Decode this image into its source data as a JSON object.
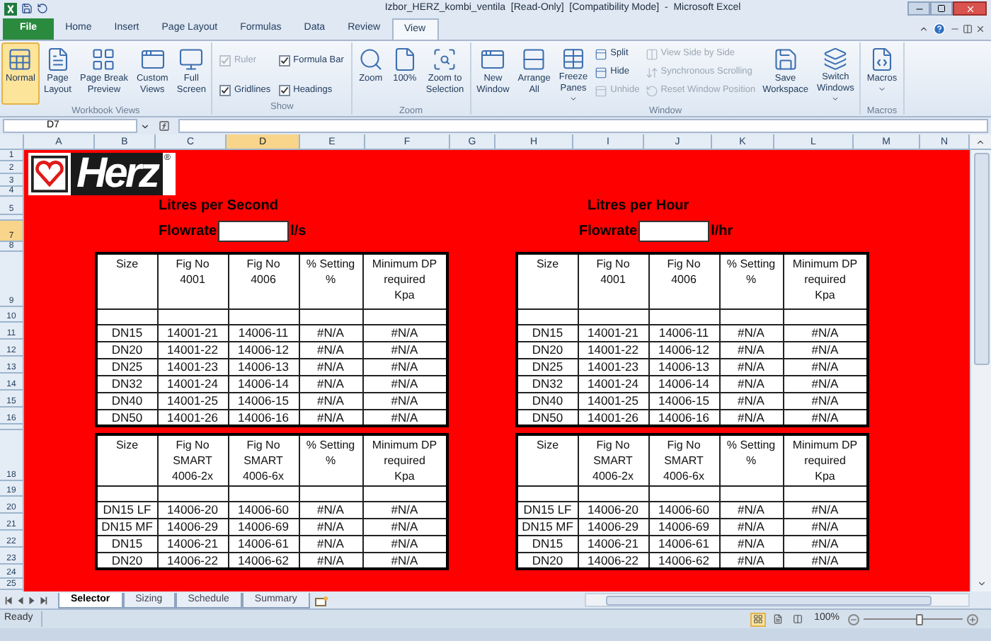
{
  "window": {
    "title": "Izbor_HERZ_kombi_ventila  [Read-Only]  [Compatibility Mode]  -  Microsoft Excel"
  },
  "ribbon_tabs": [
    {
      "label": "File",
      "kind": "file",
      "selected": false
    },
    {
      "label": "Home",
      "kind": "tab",
      "selected": false
    },
    {
      "label": "Insert",
      "kind": "tab",
      "selected": false
    },
    {
      "label": "Page Layout",
      "kind": "tab",
      "selected": false
    },
    {
      "label": "Formulas",
      "kind": "tab",
      "selected": false
    },
    {
      "label": "Data",
      "kind": "tab",
      "selected": false
    },
    {
      "label": "Review",
      "kind": "tab",
      "selected": false
    },
    {
      "label": "View",
      "kind": "tab",
      "selected": true
    }
  ],
  "ribbon_groups": [
    {
      "label": "Workbook Views",
      "items": [
        {
          "kind": "large",
          "label": "Normal",
          "selected": true
        },
        {
          "kind": "large",
          "label": "Page\nLayout",
          "selected": false
        },
        {
          "kind": "large",
          "label": "Page Break\nPreview",
          "selected": false
        },
        {
          "kind": "large",
          "label": "Custom\nViews",
          "selected": false
        },
        {
          "kind": "large",
          "label": "Full\nScreen",
          "selected": false
        }
      ]
    },
    {
      "label": "Show",
      "items": [
        {
          "kind": "check",
          "label": "Ruler",
          "checked": true,
          "disabled": true
        },
        {
          "kind": "check",
          "label": "Gridlines",
          "checked": true,
          "disabled": false
        },
        {
          "kind": "check",
          "label": "Formula Bar",
          "checked": true,
          "disabled": false
        },
        {
          "kind": "check",
          "label": "Headings",
          "checked": true,
          "disabled": false
        }
      ]
    },
    {
      "label": "Zoom",
      "items": [
        {
          "kind": "large",
          "label": "Zoom",
          "selected": false
        },
        {
          "kind": "large",
          "label": "100%",
          "selected": false
        },
        {
          "kind": "large",
          "label": "Zoom to\nSelection",
          "selected": false
        }
      ]
    },
    {
      "label": "Window",
      "items": [
        {
          "kind": "large",
          "label": "New\nWindow",
          "selected": false
        },
        {
          "kind": "large",
          "label": "Arrange\nAll",
          "selected": false
        },
        {
          "kind": "large",
          "label": "Freeze\nPanes",
          "selected": false,
          "dropdown": true
        },
        {
          "kind": "stack",
          "items": [
            {
              "label": "Split",
              "disabled": false
            },
            {
              "label": "Hide",
              "disabled": false
            },
            {
              "label": "Unhide",
              "disabled": true
            }
          ]
        },
        {
          "kind": "stack",
          "items": [
            {
              "label": "View Side by Side",
              "disabled": true
            },
            {
              "label": "Synchronous Scrolling",
              "disabled": true
            },
            {
              "label": "Reset Window Position",
              "disabled": true
            }
          ]
        },
        {
          "kind": "large",
          "label": "Save\nWorkspace",
          "selected": false
        },
        {
          "kind": "large",
          "label": "Switch\nWindows",
          "selected": false,
          "dropdown": true
        }
      ]
    },
    {
      "label": "Macros",
      "items": [
        {
          "kind": "large",
          "label": "Macros",
          "selected": false,
          "dropdown": true
        }
      ]
    }
  ],
  "formula_bar": {
    "name_box": "D7"
  },
  "column_headers": [
    {
      "label": "A",
      "selected": false
    },
    {
      "label": "B",
      "selected": false
    },
    {
      "label": "C",
      "selected": false
    },
    {
      "label": "D",
      "selected": true
    },
    {
      "label": "E",
      "selected": false
    },
    {
      "label": "F",
      "selected": false
    },
    {
      "label": "G",
      "selected": false
    },
    {
      "label": "H",
      "selected": false
    },
    {
      "label": "I",
      "selected": false
    },
    {
      "label": "J",
      "selected": false
    },
    {
      "label": "K",
      "selected": false
    },
    {
      "label": "L",
      "selected": false
    },
    {
      "label": "M",
      "selected": false
    },
    {
      "label": "N",
      "selected": false
    }
  ],
  "row_headers": [
    {
      "label": "1",
      "selected": false
    },
    {
      "label": "2",
      "selected": false
    },
    {
      "label": "3",
      "selected": false
    },
    {
      "label": "4",
      "selected": false
    },
    {
      "label": "5",
      "selected": false
    },
    {
      "selected": false
    },
    {
      "label": "7",
      "selected": true
    },
    {
      "label": "8",
      "selected": false
    },
    {
      "label": "9",
      "selected": false
    },
    {
      "label": "10",
      "selected": false
    },
    {
      "label": "11",
      "selected": false
    },
    {
      "label": "12",
      "selected": false
    },
    {
      "label": "13",
      "selected": false
    },
    {
      "label": "14",
      "selected": false
    },
    {
      "label": "15",
      "selected": false
    },
    {
      "label": "16",
      "selected": false
    },
    {
      "selected": false
    },
    {
      "label": "18",
      "selected": false
    },
    {
      "label": "19",
      "selected": false
    },
    {
      "label": "20",
      "selected": false
    },
    {
      "label": "21",
      "selected": false
    },
    {
      "label": "22",
      "selected": false
    },
    {
      "label": "23",
      "selected": false
    },
    {
      "label": "24",
      "selected": false
    },
    {
      "label": "25",
      "selected": false
    }
  ],
  "logo": {
    "text": "Herz",
    "mark": "®"
  },
  "sections": [
    {
      "title": "Litres per Second",
      "flowrate_label": "Flowrate",
      "unit": "l/s",
      "tables": [
        {
          "columns": [
            "Size",
            "Fig No\n4001",
            "Fig No\n4006",
            "% Setting\n%",
            "Minimum DP\nrequired\nKpa"
          ],
          "rows": [
            [
              "DN15",
              "14001-21",
              "14006-11",
              "#N/A",
              "#N/A"
            ],
            [
              "DN20",
              "14001-22",
              "14006-12",
              "#N/A",
              "#N/A"
            ],
            [
              "DN25",
              "14001-23",
              "14006-13",
              "#N/A",
              "#N/A"
            ],
            [
              "DN32",
              "14001-24",
              "14006-14",
              "#N/A",
              "#N/A"
            ],
            [
              "DN40",
              "14001-25",
              "14006-15",
              "#N/A",
              "#N/A"
            ],
            [
              "DN50",
              "14001-26",
              "14006-16",
              "#N/A",
              "#N/A"
            ]
          ]
        },
        {
          "columns": [
            "Size",
            "Fig No\nSMART\n4006-2x",
            "Fig No\nSMART\n4006-6x",
            "% Setting\n%",
            "Minimum DP\nrequired\nKpa"
          ],
          "rows": [
            [
              "DN15 LF",
              "14006-20",
              "14006-60",
              "#N/A",
              "#N/A"
            ],
            [
              "DN15 MF",
              "14006-29",
              "14006-69",
              "#N/A",
              "#N/A"
            ],
            [
              "DN15",
              "14006-21",
              "14006-61",
              "#N/A",
              "#N/A"
            ],
            [
              "DN20",
              "14006-22",
              "14006-62",
              "#N/A",
              "#N/A"
            ]
          ]
        }
      ]
    },
    {
      "title": "Litres per Hour",
      "flowrate_label": "Flowrate",
      "unit": "l/hr",
      "tables": [
        {
          "columns": [
            "Size",
            "Fig No\n4001",
            "Fig No\n4006",
            "% Setting\n%",
            "Minimum DP\nrequired\nKpa"
          ],
          "rows": [
            [
              "DN15",
              "14001-21",
              "14006-11",
              "#N/A",
              "#N/A"
            ],
            [
              "DN20",
              "14001-22",
              "14006-12",
              "#N/A",
              "#N/A"
            ],
            [
              "DN25",
              "14001-23",
              "14006-13",
              "#N/A",
              "#N/A"
            ],
            [
              "DN32",
              "14001-24",
              "14006-14",
              "#N/A",
              "#N/A"
            ],
            [
              "DN40",
              "14001-25",
              "14006-15",
              "#N/A",
              "#N/A"
            ],
            [
              "DN50",
              "14001-26",
              "14006-16",
              "#N/A",
              "#N/A"
            ]
          ]
        },
        {
          "columns": [
            "Size",
            "Fig No\nSMART\n4006-2x",
            "Fig No\nSMART\n4006-6x",
            "% Setting\n%",
            "Minimum DP\nrequired\nKpa"
          ],
          "rows": [
            [
              "DN15 LF",
              "14006-20",
              "14006-60",
              "#N/A",
              "#N/A"
            ],
            [
              "DN15 MF",
              "14006-29",
              "14006-69",
              "#N/A",
              "#N/A"
            ],
            [
              "DN15",
              "14006-21",
              "14006-61",
              "#N/A",
              "#N/A"
            ],
            [
              "DN20",
              "14006-22",
              "14006-62",
              "#N/A",
              "#N/A"
            ]
          ]
        }
      ]
    }
  ],
  "sheet_tabs": [
    {
      "label": "Selector",
      "selected": true
    },
    {
      "label": "Sizing",
      "selected": false
    },
    {
      "label": "Schedule",
      "selected": false
    },
    {
      "label": "Summary",
      "selected": false
    }
  ],
  "status_bar": {
    "text": "Ready",
    "view_buttons": [
      {
        "selected": true
      },
      {
        "selected": false
      },
      {
        "selected": false
      }
    ],
    "zoom_label": "100%",
    "zoom_level": {
      "level": 0.55
    }
  }
}
